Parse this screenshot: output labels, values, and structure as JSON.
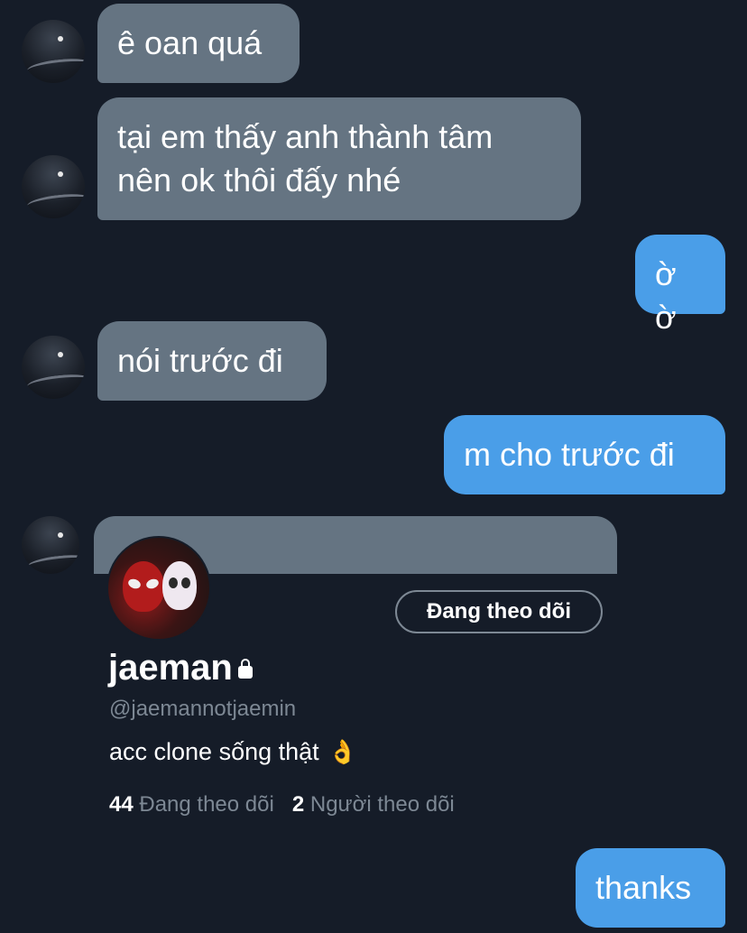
{
  "messages": [
    {
      "side": "in",
      "text": "ê oan quá"
    },
    {
      "side": "in",
      "lines": [
        "tại em thấy anh thành tâm",
        "nên ok thôi đấy nhé"
      ]
    },
    {
      "side": "out",
      "text": "ờ ờ"
    },
    {
      "side": "in",
      "text": "nói trước đi"
    },
    {
      "side": "out",
      "text": "m cho trước đi"
    },
    {
      "side": "out",
      "text": "thanks"
    }
  ],
  "profile_card": {
    "follow_button_label": "Đang theo dõi",
    "display_name": "jaeman",
    "handle": "@jaemannotjaemin",
    "bio": "acc clone sống thật",
    "bio_emoji": "👌",
    "following_count": "44",
    "following_label": "Đang theo dõi",
    "followers_count": "2",
    "followers_label": "Người theo dõi"
  },
  "colors": {
    "background": "#151c28",
    "incoming_bubble": "#657482",
    "outgoing_bubble": "#4a9ee8"
  },
  "icons": [
    "avatar",
    "lock-icon",
    "ok-hand-emoji"
  ]
}
